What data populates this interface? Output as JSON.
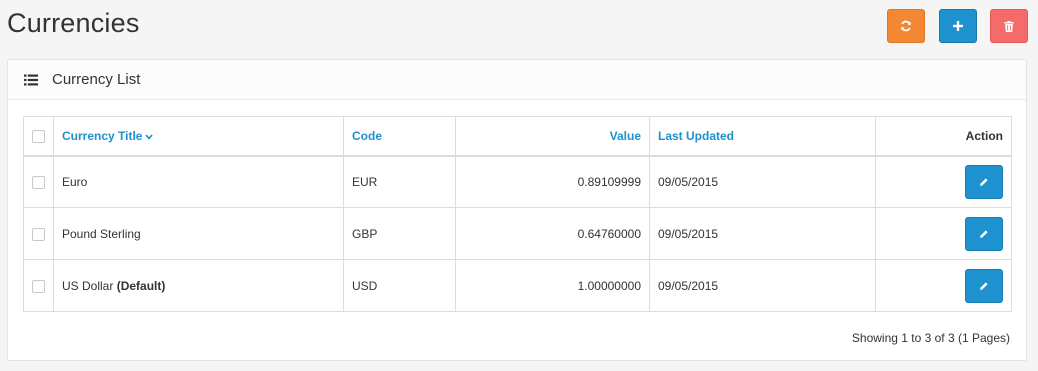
{
  "page": {
    "title": "Currencies"
  },
  "toolbar": {
    "refresh_icon": "refresh-icon",
    "add_icon": "plus-icon",
    "delete_icon": "trash-icon",
    "colors": {
      "refresh": "#f38733",
      "add": "#1e91cf",
      "delete": "#f56b6b"
    }
  },
  "panel": {
    "icon": "list-icon",
    "title": "Currency List"
  },
  "table": {
    "headers": {
      "title": "Currency Title",
      "code": "Code",
      "value": "Value",
      "updated": "Last Updated",
      "action": "Action"
    },
    "rows": [
      {
        "title": "Euro",
        "default_label": "",
        "code": "EUR",
        "value": "0.89109999",
        "updated": "09/05/2015"
      },
      {
        "title": "Pound Sterling",
        "default_label": "",
        "code": "GBP",
        "value": "0.64760000",
        "updated": "09/05/2015"
      },
      {
        "title": "US Dollar",
        "default_label": "(Default)",
        "code": "USD",
        "value": "1.00000000",
        "updated": "09/05/2015"
      }
    ]
  },
  "pagination": {
    "info": "Showing 1 to 3 of 3 (1 Pages)"
  }
}
